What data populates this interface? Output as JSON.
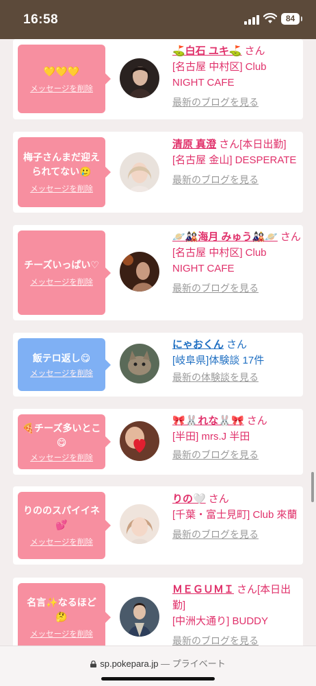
{
  "status": {
    "time": "16:58",
    "battery": "84"
  },
  "cards": [
    {
      "message": "💛💛💛",
      "delete_label": "メッセージを削除",
      "name": "⛳白石 ユキ⛳",
      "san": "さん",
      "shop": "[名古屋 中村区] Club NIGHT CAFE",
      "link": "最新のブログを見る",
      "theme": "pink"
    },
    {
      "message": "梅子さんまだ迎えられてない🥲",
      "delete_label": "メッセージを削除",
      "name": "清原 真澄",
      "san": "さん[本日出勤]",
      "shop": "[名古屋 金山] DESPERATE",
      "link": "最新のブログを見る",
      "theme": "pink"
    },
    {
      "message": "チーズいっぱい♡",
      "delete_label": "メッセージを削除",
      "name": "🪐🎎海月 みゅう🎎🪐",
      "san": "さん",
      "shop": "[名古屋 中村区] Club NIGHT CAFE",
      "link": "最新のブログを見る",
      "theme": "pink"
    },
    {
      "message": "飯テロ返し😋",
      "delete_label": "メッセージを削除",
      "name": "にゃおくん",
      "san": "さん",
      "shop": "[岐阜県]体験談 17件",
      "link": "最新の体験談を見る",
      "theme": "blue"
    },
    {
      "message": "🍕チーズ多いとこ😋",
      "delete_label": "メッセージを削除",
      "name": "🎀🐰れな🐰🎀",
      "san": "さん",
      "shop": "[半田] mrs.J 半田",
      "link": "最新のブログを見る",
      "theme": "pink"
    },
    {
      "message": "りののスパイイネ💕",
      "delete_label": "メッセージを削除",
      "name": "りの🤍",
      "san": "さん",
      "shop": "[千葉・富士見町] Club 來蘭",
      "link": "最新のブログを見る",
      "theme": "pink"
    },
    {
      "message": "名言✨なるほど🤔",
      "delete_label": "メッセージを削除",
      "name": "ＭＥＧＵＭＩ",
      "san": "さん[本日出勤]",
      "shop": "[中洲大通り] BUDDY",
      "link": "最新のブログを見る",
      "theme": "pink"
    }
  ],
  "urlbar": {
    "domain": "sp.pokepara.jp",
    "separator": " — ",
    "mode": "プライベート"
  },
  "colors": {
    "pink_bubble": "#f78fa0",
    "blue_bubble": "#7fb0f4",
    "name_pink": "#e0306a",
    "name_blue": "#1f6fc2",
    "status_bg": "#5c4a3a"
  }
}
